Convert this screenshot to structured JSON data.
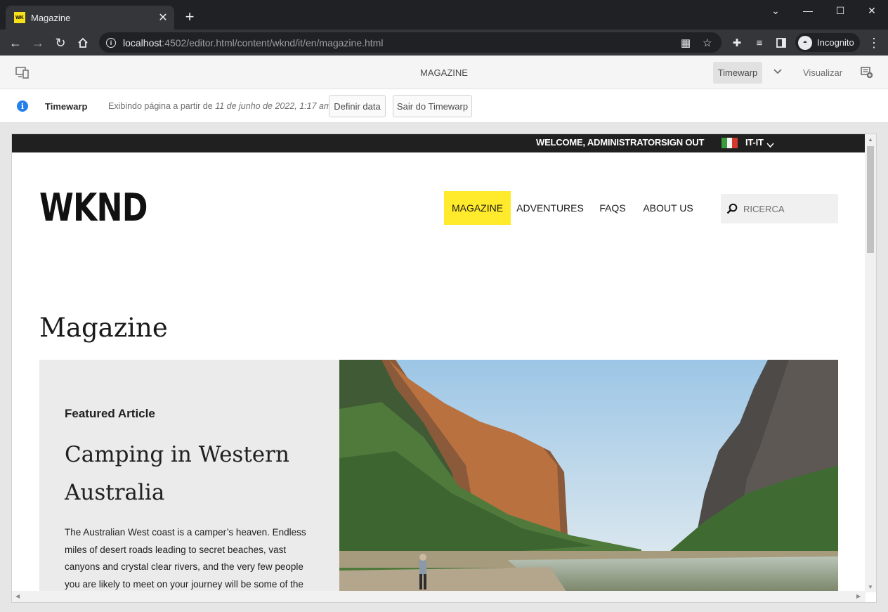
{
  "browser": {
    "tab_title": "Magazine",
    "favicon_text": "WK",
    "url_host": "localhost",
    "url_path": ":4502/editor.html/content/wknd/it/en/magazine.html",
    "profile_label": "Incognito"
  },
  "editor": {
    "page_title": "MAGAZINE",
    "timewarp_label": "Timewarp",
    "visualizar_label": "Visualizar"
  },
  "timewarp": {
    "label": "Timewarp",
    "text_prefix": "Exibindo página a partir de ",
    "text_date": "11 de junho de 2022, 1:17 am",
    "set_date_label": "Definir data",
    "exit_label": "Sair do Timewarp"
  },
  "site": {
    "welcome": "WELCOME, ADMINISTRATOR",
    "sign_out": "SIGN OUT",
    "language": "IT-IT",
    "logo": "WKND",
    "nav": [
      "MAGAZINE",
      "ADVENTURES",
      "FAQS",
      "ABOUT US"
    ],
    "search_placeholder": "RICERCA",
    "page_title": "Magazine",
    "featured": {
      "eyebrow": "Featured Article",
      "title": "Camping in Western Australia",
      "body": "The Australian West coast is a camper’s heaven. Endless miles of desert roads leading to secret beaches, vast canyons and crystal clear rivers, and the very few people you are likely to meet on your journey will be some of the most easy-"
    }
  },
  "colors": {
    "accent_yellow": "#ffea2b",
    "info_blue": "#2680eb",
    "chrome_dark": "#202124"
  }
}
